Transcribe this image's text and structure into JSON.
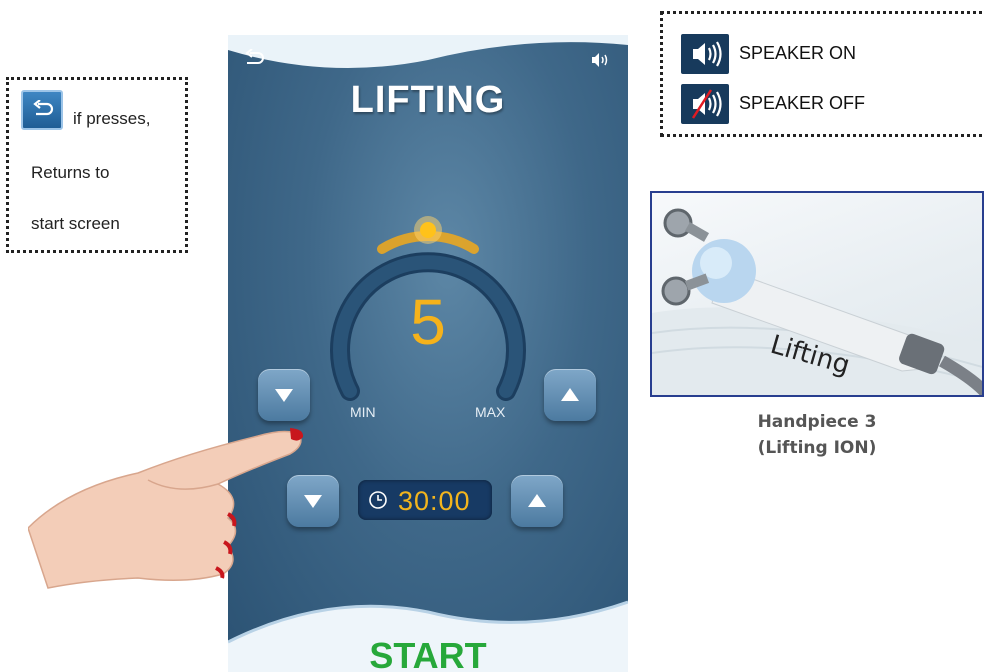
{
  "callout_back": {
    "line1": "if presses,",
    "line2": "Returns to",
    "line3": "start screen"
  },
  "callout_speaker": {
    "on_label": "SPEAKER ON",
    "off_label": "SPEAKER OFF",
    "on_icon": "speaker-on-icon",
    "off_icon": "speaker-off-icon"
  },
  "handpiece": {
    "image_text": "Lifting",
    "caption_line1": "Handpiece 3",
    "caption_line2": "(Lifting ION)"
  },
  "device": {
    "title": "LIFTING",
    "level": "5",
    "level_value": 5,
    "min_label": "MIN",
    "max_label": "MAX",
    "timer": "30:00",
    "start_label": "START",
    "icons": {
      "back": "back-arrow-icon",
      "speaker": "speaker-on-icon",
      "timer": "clock-icon",
      "decrease": "triangle-down-icon",
      "increase": "triangle-up-icon"
    },
    "colors": {
      "accent": "#f5b21b",
      "start": "#27a83a",
      "screen": "#3f6889"
    }
  }
}
